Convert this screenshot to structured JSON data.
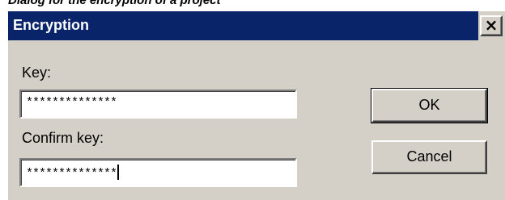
{
  "caption": "Dialog for the encryption of a project",
  "window": {
    "title": "Encryption",
    "close_symbol": "×",
    "title_bar_color": "#0a246a",
    "face_color": "#d4d0c8"
  },
  "form": {
    "key_label": "Key:",
    "key_value": "**************",
    "confirm_label": "Confirm key:",
    "confirm_value": "**************"
  },
  "buttons": {
    "ok_label": "OK",
    "cancel_label": "Cancel"
  },
  "icons": {
    "close": "close-icon"
  }
}
